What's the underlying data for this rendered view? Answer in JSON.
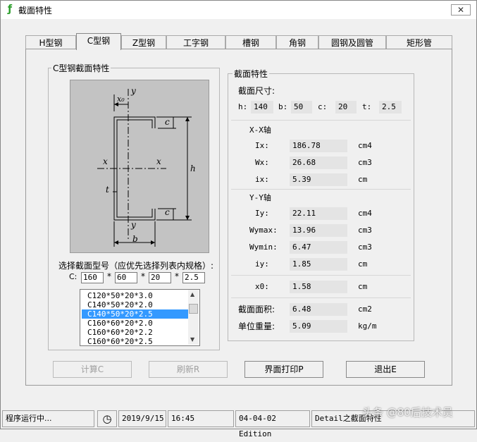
{
  "window": {
    "title": "截面特性",
    "close_glyph": "✕"
  },
  "tabs": [
    "H型钢",
    "C型钢",
    "Z型钢",
    "工字钢",
    "槽钢",
    "角钢",
    "圆钢及圆管",
    "矩形管"
  ],
  "active_tab": 1,
  "left_group": {
    "label": "C型钢截面特性",
    "diagram": {
      "y_top": "y",
      "x0": "x₀",
      "c_top": "c",
      "x_left": "x",
      "x_right": "x",
      "h": "h",
      "t": "t",
      "c_bottom": "c",
      "y_bottom": "y",
      "b": "b"
    },
    "select_label": "选择截面型号（应优先选择列表内规格）:",
    "dims_prefix": "C:",
    "dims": [
      "160",
      "60",
      "20",
      "2.5"
    ],
    "separators": [
      "*",
      "*",
      "*"
    ],
    "list_items": [
      "C120*50*20*3.0",
      "C140*50*20*2.0",
      "C140*50*20*2.5",
      "C160*60*20*2.0",
      "C160*60*20*2.2",
      "C160*60*20*2.5"
    ],
    "selected_index": 2
  },
  "right_group": {
    "label": "截面特性",
    "size_label": "截面尺寸:",
    "dims": [
      {
        "label": "h:",
        "value": "140"
      },
      {
        "label": "b:",
        "value": "50"
      },
      {
        "label": "c:",
        "value": "20"
      },
      {
        "label": "t:",
        "value": "2.5"
      }
    ],
    "xx_title": "X-X轴",
    "xx": [
      {
        "label": "Ix:",
        "value": "186.78",
        "unit": "cm4"
      },
      {
        "label": "Wx:",
        "value": "26.68",
        "unit": "cm3"
      },
      {
        "label": "ix:",
        "value": "5.39",
        "unit": "cm"
      }
    ],
    "yy_title": "Y-Y轴",
    "yy": [
      {
        "label": "Iy:",
        "value": "22.11",
        "unit": "cm4"
      },
      {
        "label": "Wymax:",
        "value": "13.96",
        "unit": "cm3"
      },
      {
        "label": "Wymin:",
        "value": "6.47",
        "unit": "cm3"
      },
      {
        "label": "iy:",
        "value": "1.85",
        "unit": "cm"
      }
    ],
    "x0": {
      "label": "x0:",
      "value": "1.58",
      "unit": "cm"
    },
    "area": {
      "label": "截面面积:",
      "value": "6.48",
      "unit": "cm2"
    },
    "weight": {
      "label": "单位重量:",
      "value": "5.09",
      "unit": "kg/m"
    }
  },
  "buttons": {
    "calc": "计算C",
    "refresh": "刷新R",
    "print": "界面打印P",
    "exit": "退出E"
  },
  "status": {
    "running": "程序运行中...",
    "date": "2019/9/15",
    "time": "16:45",
    "edition": "04-04-02 Edition",
    "detail": "Detail之截面特性"
  },
  "watermark": "头条 @80后技术员"
}
